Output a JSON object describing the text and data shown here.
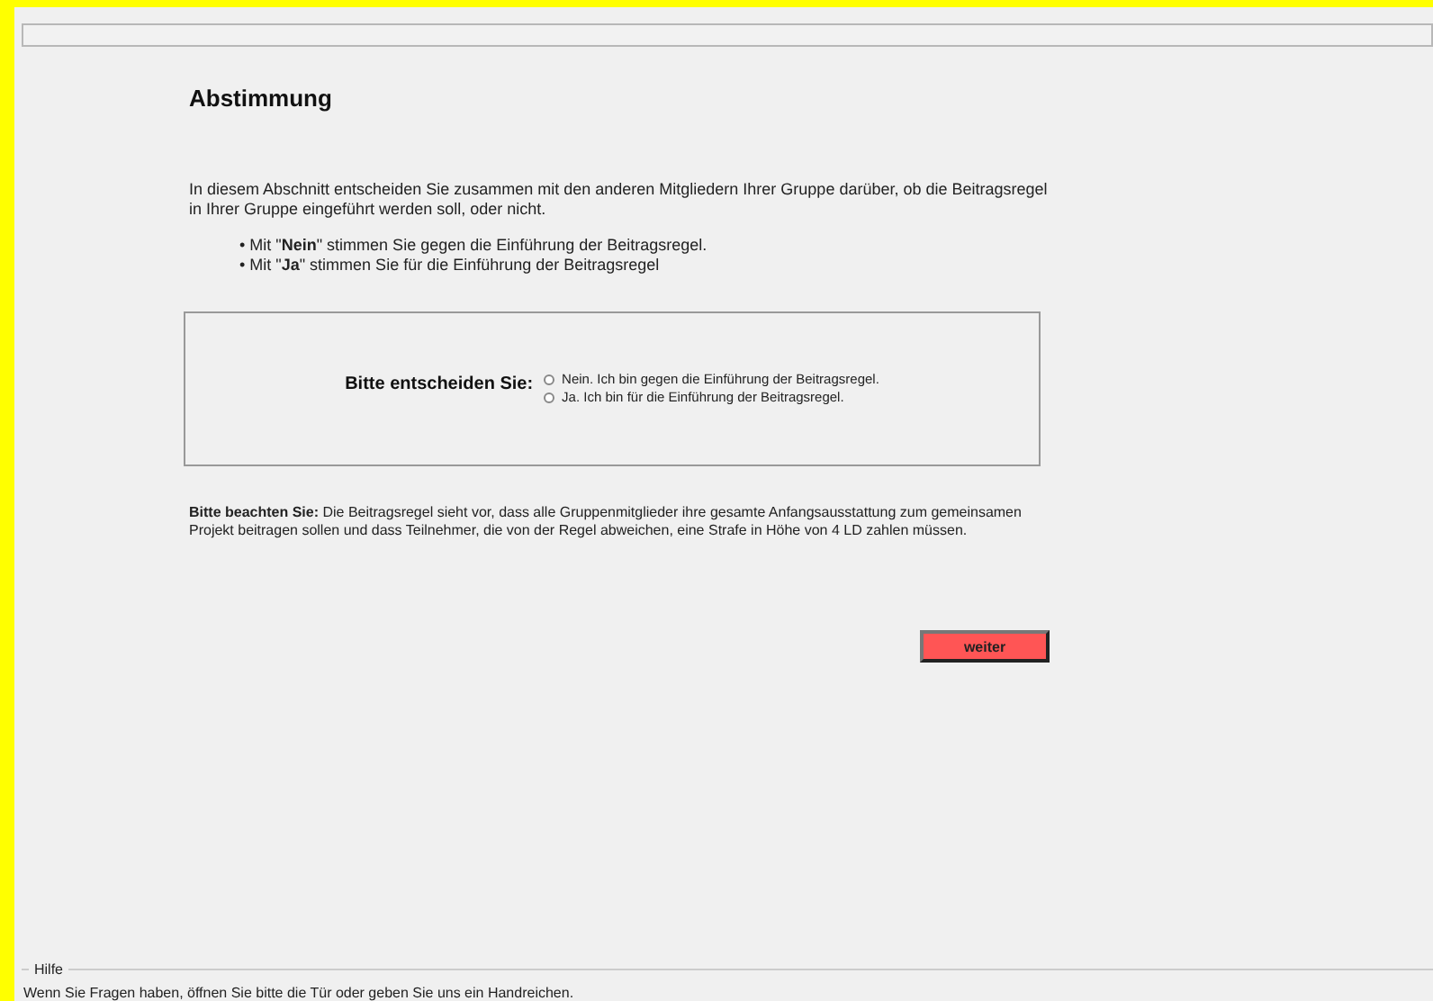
{
  "title": "Abstimmung",
  "intro": "In diesem Abschnitt entscheiden Sie zusammen mit den anderen Mitgliedern Ihrer Gruppe darüber, ob die Beitragsregel in Ihrer Gruppe eingeführt werden soll, oder nicht.",
  "bullets": [
    "• Mit \"**Nein**\" stimmen Sie gegen die Einführung der Beitragsregel.",
    "• Mit \"**Ja**\" stimmen Sie für die Einführung der Beitragsregel"
  ],
  "question": {
    "label": "Bitte entscheiden Sie:",
    "options": [
      {
        "label": "Nein. Ich bin gegen die Einführung der Beitragsregel.",
        "selected": false
      },
      {
        "label": "Ja. Ich bin für die Einführung der Beitragsregel.",
        "selected": false
      }
    ]
  },
  "note": "**Bitte beachten Sie:** Die Beitragsregel sieht vor, dass alle Gruppenmitglieder ihre gesamte Anfangsausstattung zum gemeinsamen Projekt beitragen sollen und dass Teilnehmer, die von der Regel abweichen, eine Strafe in Höhe von 4 LD zahlen müssen.",
  "button": "weiter",
  "help": {
    "title": "Hilfe",
    "text": "Wenn Sie Fragen haben, öffnen Sie bitte die Tür oder geben Sie uns ein Handreichen."
  }
}
